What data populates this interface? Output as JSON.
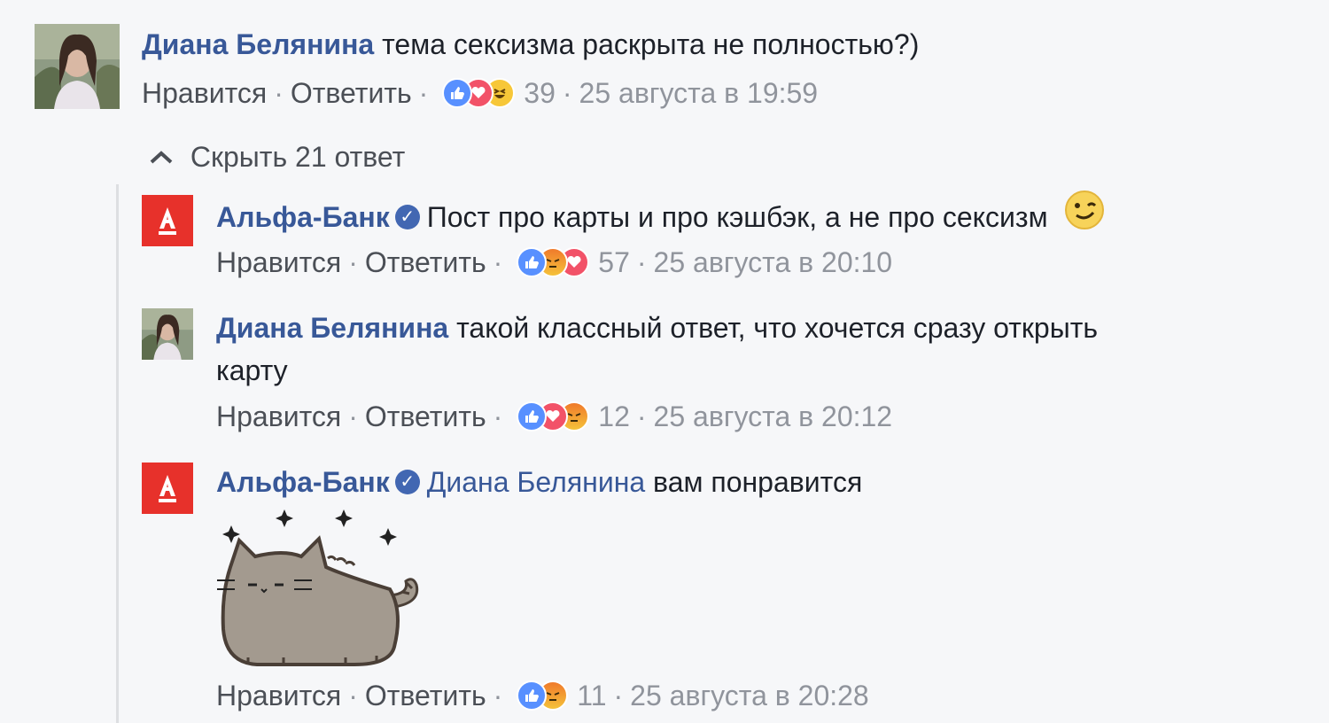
{
  "comments": [
    {
      "author": "Диана Белянина",
      "text": "тема сексизма раскрыта не полностью?)",
      "like_label": "Нравится",
      "reply_label": "Ответить",
      "reactions": [
        "like",
        "love",
        "haha"
      ],
      "reaction_count": "39",
      "timestamp": "25 августа в 19:59"
    }
  ],
  "replies_toggle": {
    "label": "Скрыть 21 ответ",
    "icon": "chevron-up-icon"
  },
  "replies": [
    {
      "author": "Альфа-Банк",
      "verified": true,
      "text": "Пост про карты и про кэшбэк, а не про сексизм",
      "emoji": "wink-emoji",
      "like_label": "Нравится",
      "reply_label": "Ответить",
      "reactions": [
        "like",
        "angry",
        "love"
      ],
      "reaction_count": "57",
      "timestamp": "25 августа в 20:10"
    },
    {
      "author": "Диана Белянина",
      "text_line1": "такой классный ответ, что хочется сразу открыть",
      "text_line2": "карту",
      "like_label": "Нравится",
      "reply_label": "Ответить",
      "reactions": [
        "like",
        "love",
        "angry"
      ],
      "reaction_count": "12",
      "timestamp": "25 августа в 20:12"
    },
    {
      "author": "Альфа-Банк",
      "verified": true,
      "mention": "Диана Белянина",
      "text": "вам понравится",
      "sticker": "pusheen-cat-sticker",
      "like_label": "Нравится",
      "reply_label": "Ответить",
      "reactions": [
        "like",
        "angry"
      ],
      "reaction_count": "11",
      "timestamp": "25 августа в 20:28"
    }
  ],
  "colors": {
    "name_link": "#385898",
    "meta_text": "#90949c",
    "alfa_red": "#e7312b",
    "like_blue": "#5890ff",
    "love_red": "#f25268"
  }
}
